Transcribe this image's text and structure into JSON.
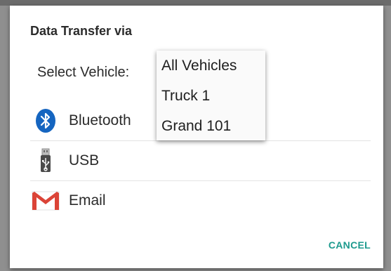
{
  "dialog": {
    "title": "Data Transfer via",
    "select_label": "Select Vehicle:",
    "cancel_label": "CANCEL"
  },
  "options": [
    {
      "label": "Bluetooth",
      "icon": "bluetooth-icon"
    },
    {
      "label": "USB",
      "icon": "usb-icon"
    },
    {
      "label": "Email",
      "icon": "gmail-icon"
    }
  ],
  "vehicle_dropdown": {
    "items": [
      "All Vehicles",
      "Truck 1",
      "Grand 101"
    ]
  },
  "colors": {
    "accent": "#1d9a8e",
    "bluetooth": "#1565c0",
    "gmail_red": "#db4437"
  }
}
